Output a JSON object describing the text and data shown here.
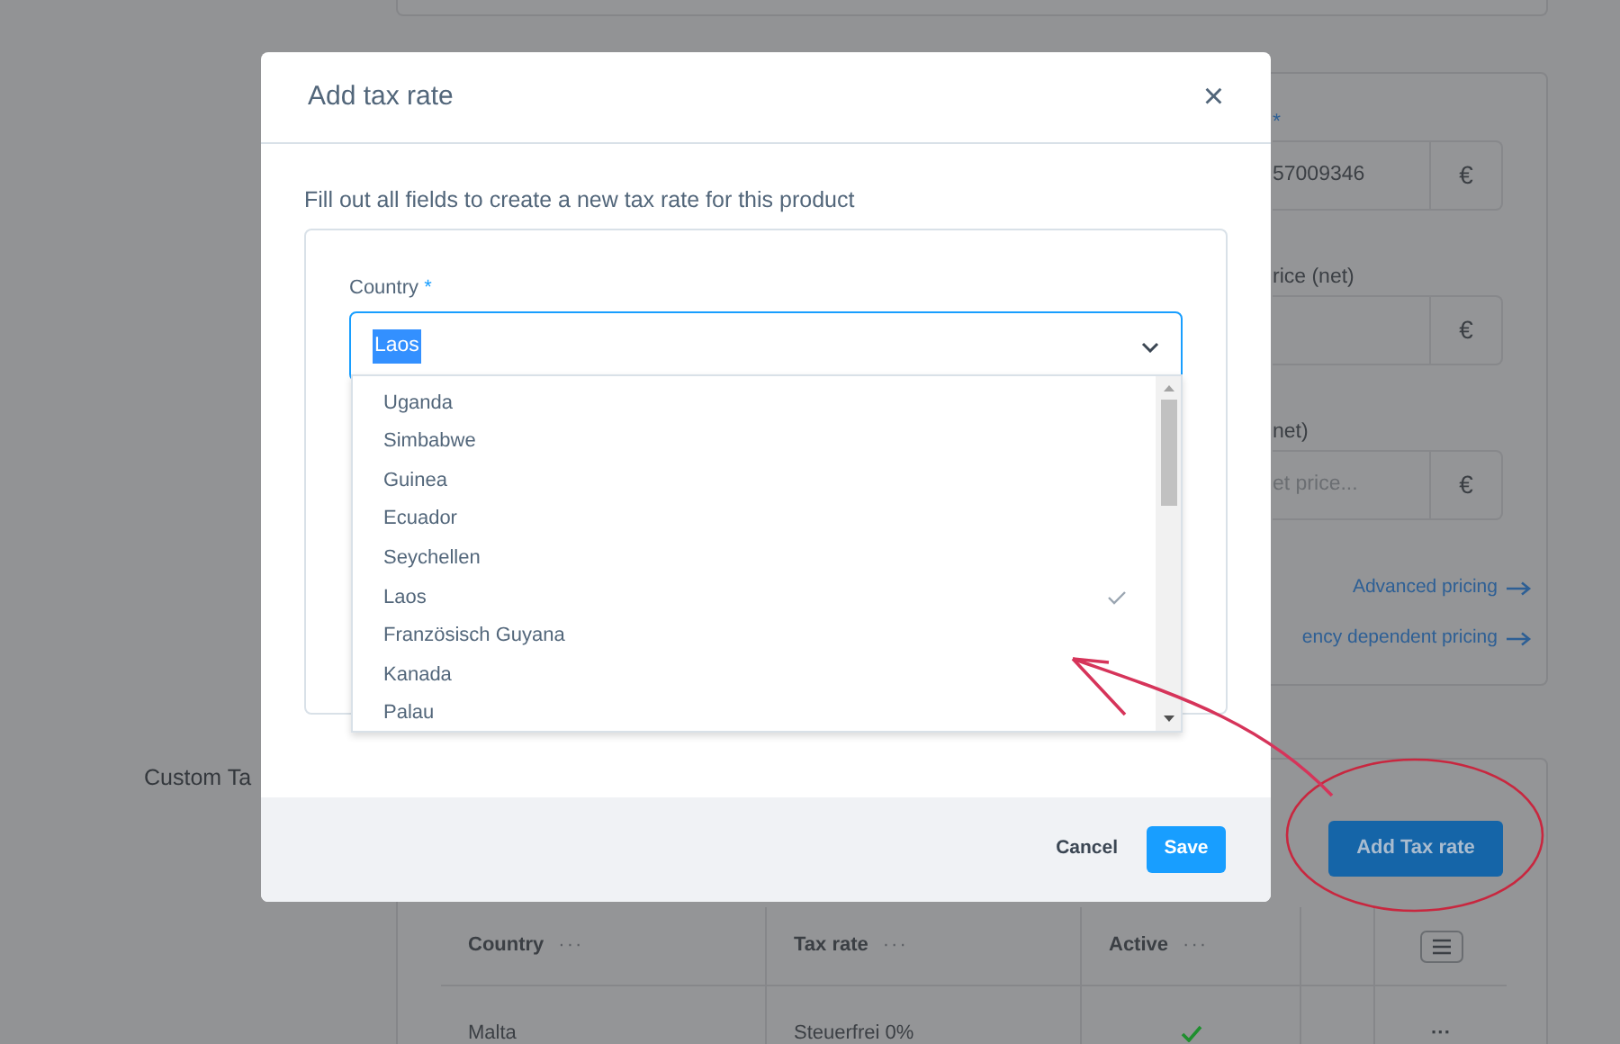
{
  "price_panel": {
    "fields": [
      {
        "required_mark": "*",
        "value": "57009346",
        "addon": "€"
      },
      {
        "label": "rice (net)",
        "addon": "€"
      },
      {
        "label": "net)",
        "placeholder": "et price...",
        "addon": "€"
      }
    ],
    "links": [
      "Advanced pricing",
      "ency dependent pricing"
    ]
  },
  "custom_tax": {
    "section_title": "Custom Ta",
    "add_button": "Add Tax rate",
    "columns": [
      {
        "label": "Country",
        "menu": "···"
      },
      {
        "label": "Tax rate",
        "menu": "···"
      },
      {
        "label": "Active",
        "menu": "···"
      }
    ],
    "rows": [
      {
        "country": "Malta",
        "tax_rate": "Steuerfrei 0%",
        "active": true,
        "more": "···"
      }
    ]
  },
  "modal": {
    "title": "Add tax rate",
    "close": "×",
    "intro": "Fill out all fields to create a new tax rate for this product",
    "country_field": {
      "label": "Country",
      "required_mark": "*",
      "value": "Laos",
      "options": [
        {
          "label": "Uganda",
          "selected": false
        },
        {
          "label": "Simbabwe",
          "selected": false
        },
        {
          "label": "Guinea",
          "selected": false
        },
        {
          "label": "Ecuador",
          "selected": false
        },
        {
          "label": "Seychellen",
          "selected": false
        },
        {
          "label": "Laos",
          "selected": true
        },
        {
          "label": "Französisch Guyana",
          "selected": false
        },
        {
          "label": "Kanada",
          "selected": false
        },
        {
          "label": "Palau",
          "selected": false
        }
      ]
    },
    "buttons": [
      {
        "label": "Cancel",
        "kind": "link"
      },
      {
        "label": "Save",
        "kind": "primary"
      }
    ]
  }
}
